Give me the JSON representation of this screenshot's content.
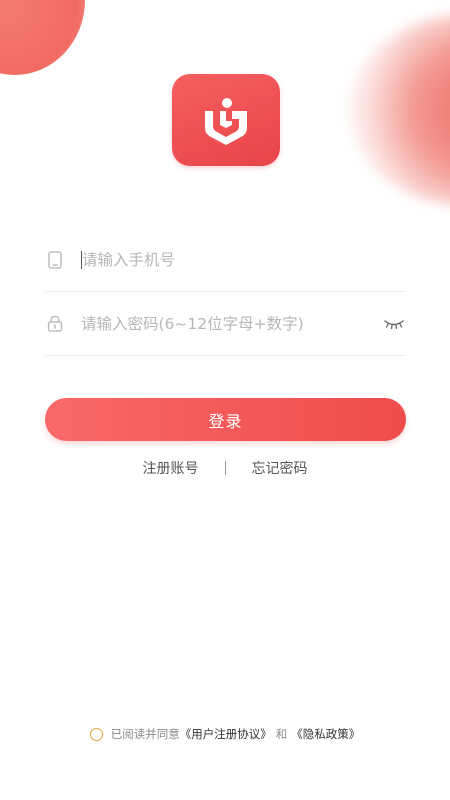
{
  "login": {
    "phone_placeholder": "请输入手机号",
    "password_placeholder": "请输入密码(6~12位字母+数字)",
    "login_label": "登录",
    "register_label": "注册账号",
    "forgot_label": "忘记密码"
  },
  "agreement": {
    "prefix": "已阅读并同意",
    "user_agreement": "《用户注册协议》",
    "connector": "和",
    "privacy_policy": "《隐私政策》"
  },
  "icons": {
    "logo": "app-logo",
    "phone": "phone-icon",
    "lock": "lock-icon",
    "eye": "eye-closed-icon"
  },
  "colors": {
    "accent": "#ef4b4b",
    "radio_border": "#e2a23a"
  }
}
